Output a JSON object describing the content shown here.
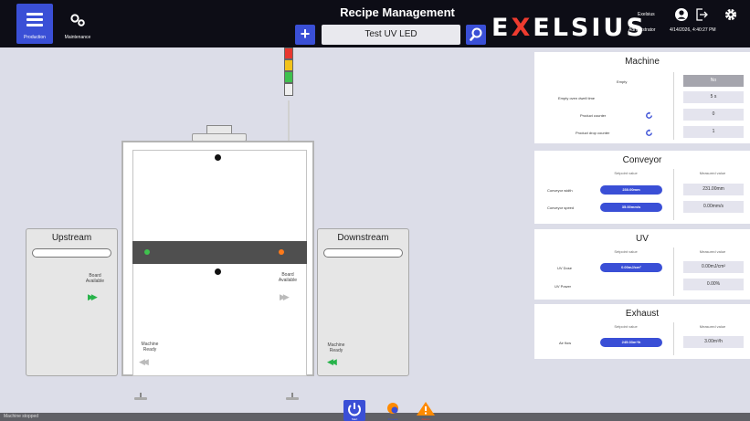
{
  "header": {
    "title": "Recipe Management",
    "recipe_value": "Test UV LED",
    "logo_prefix": "E",
    "logo_x": "X",
    "logo_suffix": "ELSIUS",
    "user_name": "Exelsius",
    "user_role": "Administrator",
    "datetime": "4/14/2026, 4:40:27 PM",
    "nav": [
      {
        "label": "Production",
        "icon": "menu-icon",
        "active": true
      },
      {
        "label": "Maintenance",
        "icon": "gears-icon",
        "active": false
      }
    ],
    "icons": [
      "account-icon",
      "logout-icon",
      "settings-icon"
    ]
  },
  "machine_view": {
    "upstream": {
      "title": "Upstream",
      "board_label": "Board Available",
      "ready_label": "Machine Ready"
    },
    "downstream": {
      "title": "Downstream",
      "board_label": "Board Available",
      "ready_label": "Machine Ready"
    },
    "stack_light": [
      "red",
      "yellow",
      "green"
    ],
    "colors": {
      "active_arrow": "#27b34a",
      "inactive_arrow": "#bbbbbb",
      "band": "#4f4f4f"
    }
  },
  "panels": {
    "machine": {
      "title": "Machine",
      "rows": [
        {
          "label": "Empty",
          "value": "No"
        },
        {
          "label": "Empty oven dwell time",
          "value": "5 s"
        },
        {
          "label": "Product counter",
          "value": "0"
        },
        {
          "label": "Product drop counter",
          "value": "1"
        }
      ]
    },
    "conveyor": {
      "title": "Conveyor",
      "setpoint_header": "Setpoint value",
      "measured_header": "Measured value",
      "rows": [
        {
          "label": "Conveyor width",
          "setpoint": "230.00mm",
          "measured": "231.00mm"
        },
        {
          "label": "Conveyor speed",
          "setpoint": "35.00mm/s",
          "measured": "0.00mm/s"
        }
      ]
    },
    "uv": {
      "title": "UV",
      "setpoint_header": "Setpoint value",
      "measured_header": "Measured value",
      "rows": [
        {
          "label": "UV Dose",
          "setpoint": "0.00mJ/cm²",
          "measured": "0.00mJ/cm²"
        },
        {
          "label": "UV Power",
          "setpoint": "",
          "measured": "0.00%"
        }
      ]
    },
    "exhaust": {
      "title": "Exhaust",
      "setpoint_header": "Setpoint value",
      "measured_header": "Measured value",
      "rows": [
        {
          "label": "Air flow",
          "setpoint": "245.03m³/h",
          "measured": "3.00m³/h"
        }
      ]
    }
  },
  "footer": {
    "status": "Machine stopped",
    "buttons": [
      {
        "label": "Start",
        "icon": "power-icon",
        "color": "#3a4fd6"
      },
      {
        "label": "Process",
        "icon": "process-icon",
        "color": "#ff8a00"
      },
      {
        "label": "Alarms",
        "icon": "warning-icon",
        "color": "#ff8a00"
      }
    ]
  }
}
